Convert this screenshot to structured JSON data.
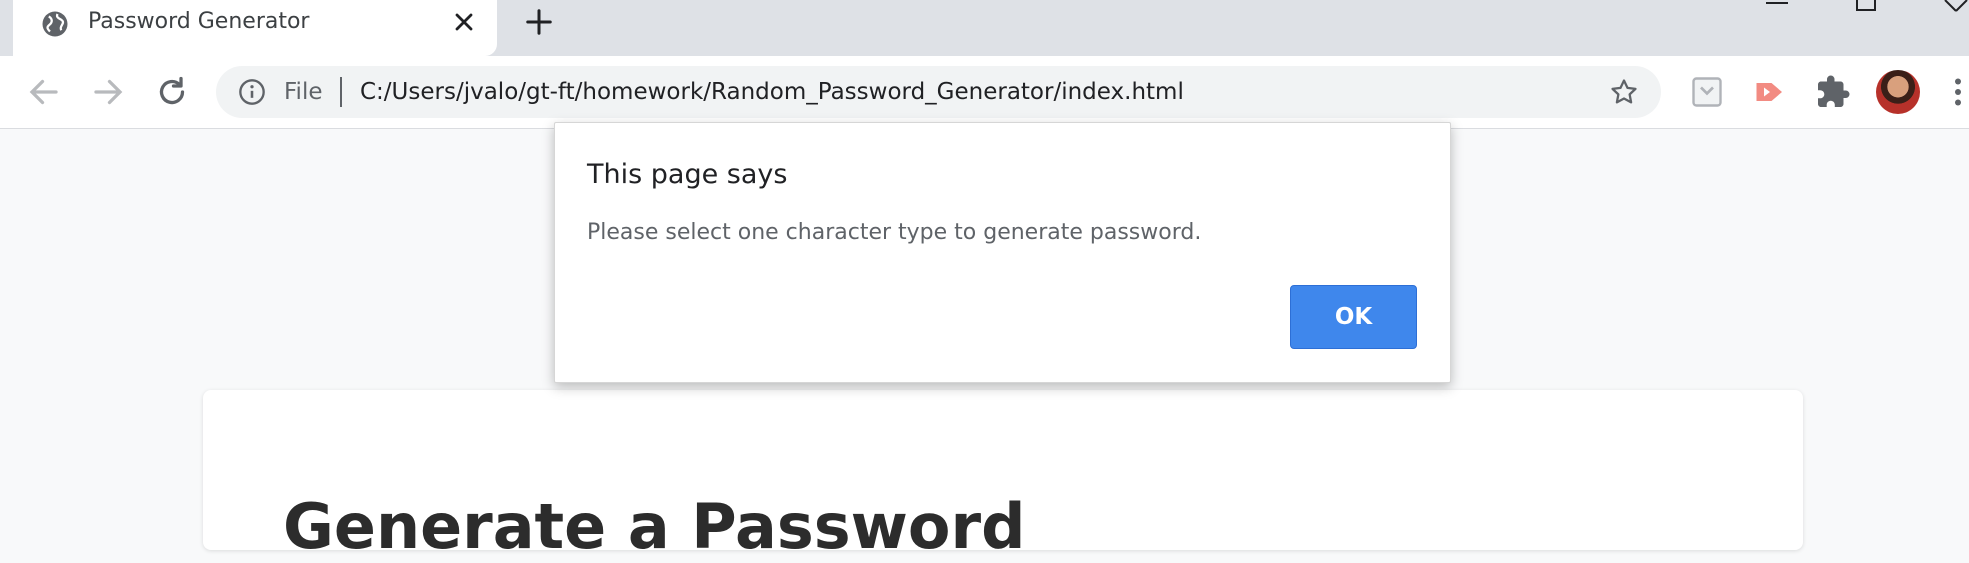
{
  "browser": {
    "tab": {
      "title": "Password Generator",
      "favicon": "globe-icon"
    },
    "address_bar": {
      "scheme_label": "File",
      "url": "C:/Users/jvalo/gt-ft/homework/Random_Password_Generator/index.html"
    }
  },
  "page": {
    "heading": "Generate a Password"
  },
  "dialog": {
    "title": "This page says",
    "message": "Please select one character type to generate password.",
    "ok_label": "OK",
    "accent_color": "#3f87ec"
  },
  "icons": {
    "tab_close": "close-icon",
    "new_tab": "plus-icon",
    "back": "back-arrow-icon",
    "forward": "forward-arrow-icon",
    "reload": "reload-icon",
    "site_info": "info-icon",
    "bookmark": "star-icon",
    "extensions": "puzzle-icon",
    "menu": "kebab-menu-icon"
  }
}
